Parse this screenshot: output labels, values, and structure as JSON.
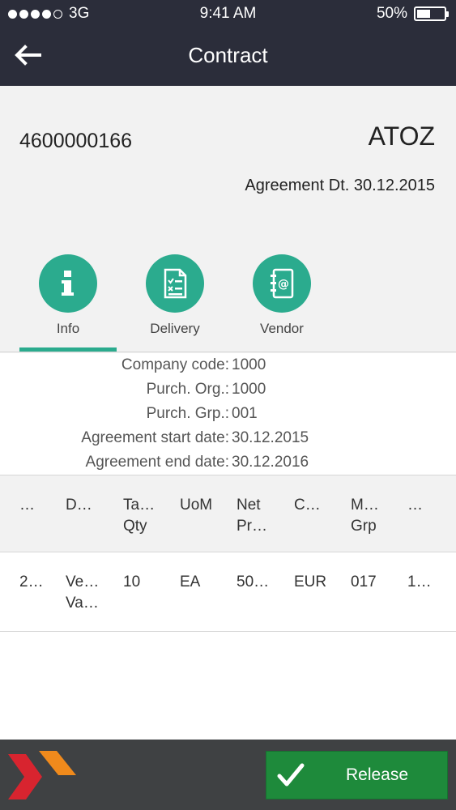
{
  "status_bar": {
    "carrier": "3G",
    "time": "9:41 AM",
    "battery": "50%",
    "battery_level": 0.5
  },
  "nav": {
    "title": "Contract"
  },
  "contract": {
    "number": "4600000166",
    "vendor_code": "ATOZ",
    "agreement_date": "Agreement Dt. 30.12.2015"
  },
  "tabs": [
    {
      "label": "Info",
      "icon": "info-icon",
      "active": true
    },
    {
      "label": "Delivery",
      "icon": "document-checklist-icon",
      "active": false
    },
    {
      "label": "Vendor",
      "icon": "address-book-icon",
      "active": false
    }
  ],
  "info": [
    {
      "key": "Company code:",
      "value": "1000"
    },
    {
      "key": "Purch. Org.:",
      "value": "1000"
    },
    {
      "key": "Purch. Grp.:",
      "value": "001"
    },
    {
      "key": "Agreement start date:",
      "value": "30.12.2015"
    },
    {
      "key": "Agreement end date:",
      "value": "30.12.2016"
    }
  ],
  "table": {
    "headers": [
      "…",
      "D…",
      "Ta…\nQty",
      "UoM",
      "Net\nPr…",
      "C…",
      "M…\nGrp",
      "…"
    ],
    "rows": [
      [
        "2…",
        "Ve…\nVa…",
        "10",
        "EA",
        "50…",
        "EUR",
        "017",
        "1…"
      ]
    ]
  },
  "footer": {
    "release_label": "Release"
  },
  "colors": {
    "header_dark": "#2b2d3a",
    "accent_teal": "#2bab8e",
    "release_green": "#1e8a3b",
    "footer_dark": "#3f4143"
  }
}
